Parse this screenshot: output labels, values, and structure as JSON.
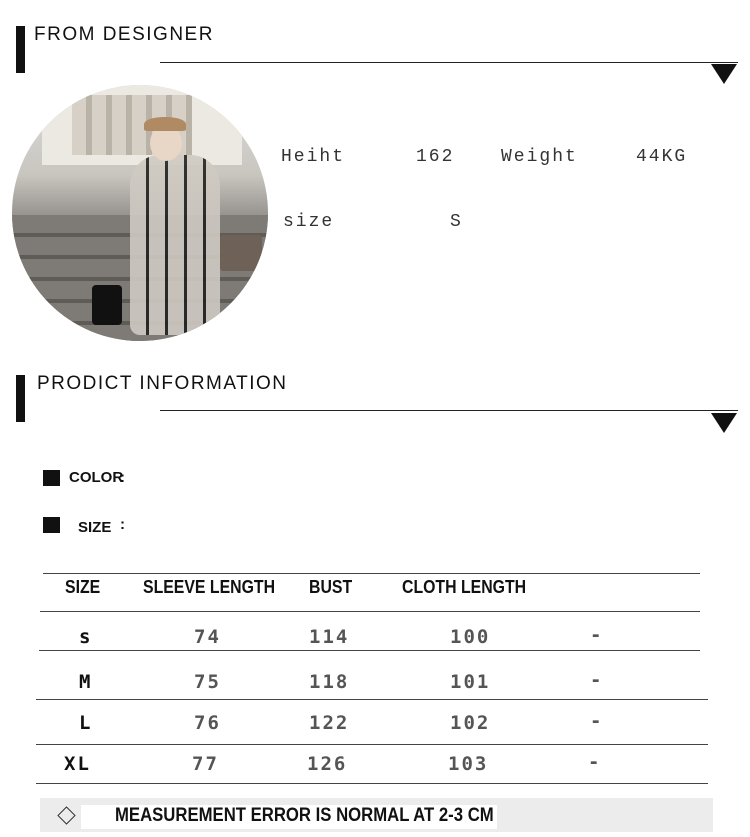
{
  "designer": {
    "title": "FROM DESIGNER",
    "height_label": "Heiht",
    "height_value": "162",
    "weight_label": "Weight",
    "weight_value": "44KG",
    "size_label": "size",
    "size_value": "S"
  },
  "product": {
    "title": "PRODICT INFORMATION",
    "color_label": "COLOR",
    "size_label": "SIZE",
    "colon": ":"
  },
  "table": {
    "headers": [
      "SIZE",
      "SLEEVE LENGTH",
      "BUST",
      "CLOTH LENGTH"
    ],
    "rows": [
      [
        "s",
        "74",
        "114",
        "100",
        "-"
      ],
      [
        "M",
        "75",
        "118",
        "101",
        "-"
      ],
      [
        "L",
        "76",
        "122",
        "102",
        "-"
      ],
      [
        "XL",
        "77",
        "126",
        "103",
        "-"
      ]
    ]
  },
  "note": {
    "icon": "diamond-outline-icon",
    "text": "MEASUREMENT ERROR IS NORMAL AT 2-3 CM"
  }
}
